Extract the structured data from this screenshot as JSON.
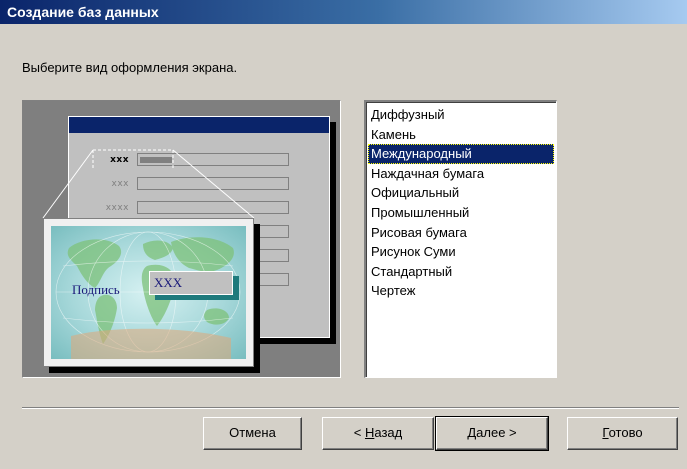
{
  "window": {
    "title": "Создание баз данных"
  },
  "instruction": "Выберите вид оформления экрана.",
  "preview": {
    "form_labels": [
      "xxx",
      "xxx",
      "xxxx"
    ],
    "card": {
      "label": "Подпись",
      "value": "XXX"
    }
  },
  "styles": {
    "items": [
      "Диффузный",
      "Камень",
      "Международный",
      "Наждачная бумага",
      "Официальный",
      "Промышленный",
      "Рисовая бумага",
      "Рисунок Суми",
      "Стандартный",
      "Чертеж"
    ],
    "selected_index": 2
  },
  "buttons": {
    "cancel": "Отмена",
    "back_prefix": "< ",
    "back_mnemonic": "Н",
    "back_rest": "азад",
    "next_mnemonic": "Д",
    "next_rest": "алее >",
    "finish_mnemonic": "Г",
    "finish_rest": "отово"
  },
  "colors": {
    "titlebar": "#0a246a",
    "selection": "#0a246a",
    "dialog_bg": "#d4d0c8"
  }
}
